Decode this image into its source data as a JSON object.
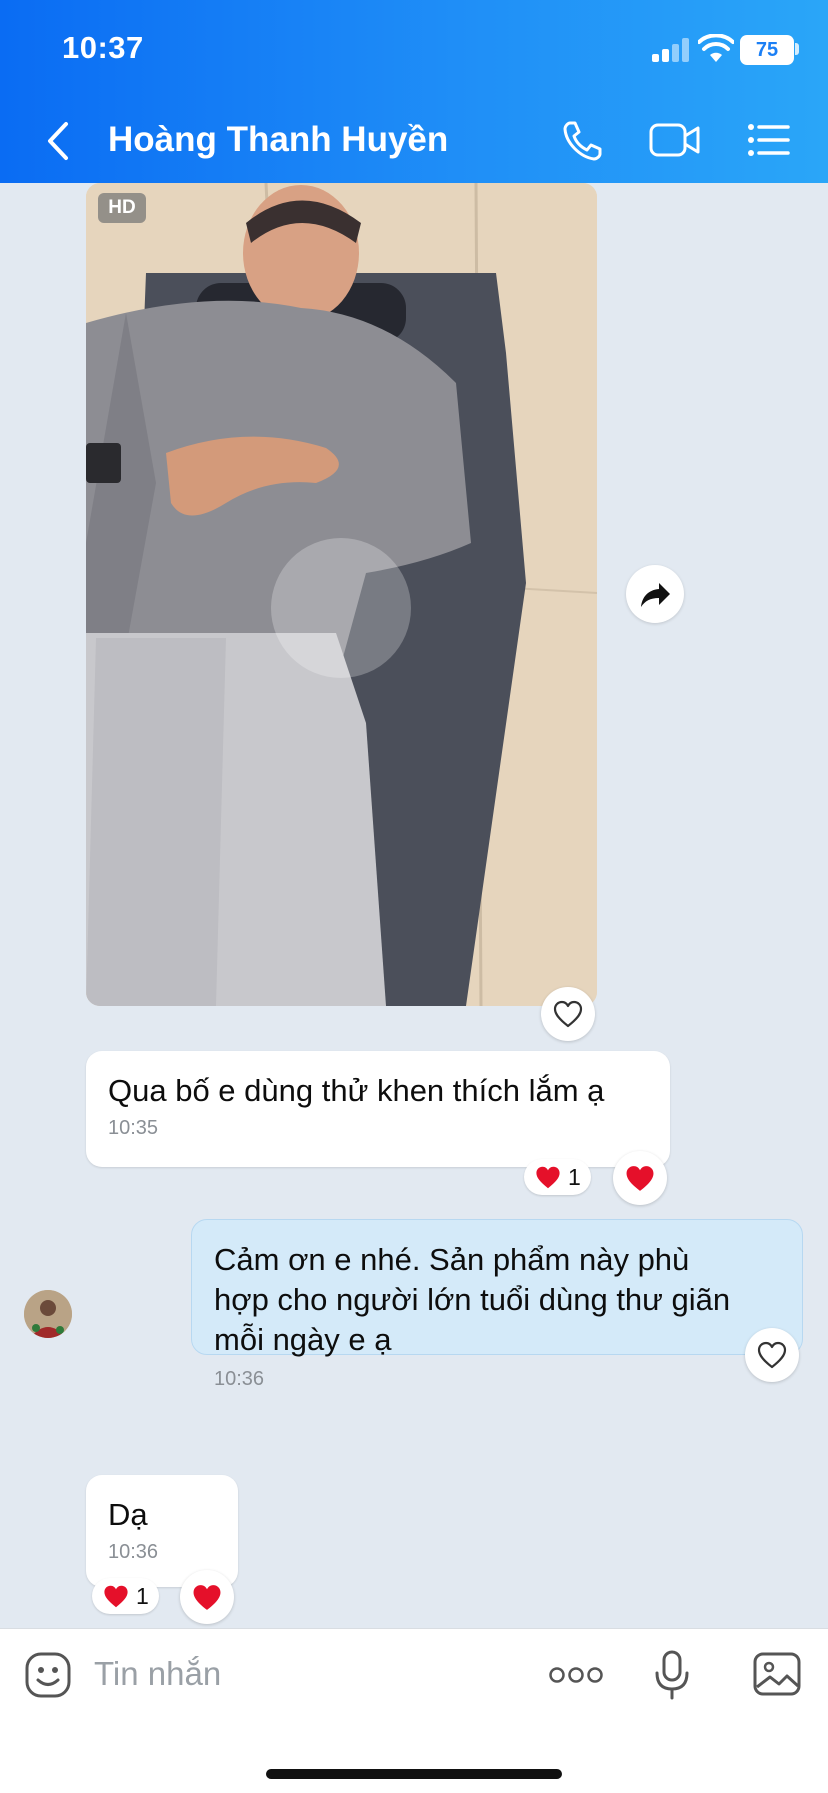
{
  "status_bar": {
    "time": "10:37",
    "battery": "75"
  },
  "header": {
    "title": "Hoàng Thanh Huyền"
  },
  "messages": {
    "photo": {
      "badge": "HD"
    },
    "m1": {
      "text": "Qua bố e dùng thử khen thích lắm ạ",
      "time": "10:35",
      "reaction_count": "1"
    },
    "m2": {
      "lines": [
        "Cảm ơn e nhé. Sản phẩm này phù",
        "hợp cho người lớn tuổi dùng thư giãn",
        "mỗi ngày e ạ"
      ],
      "time": "10:36"
    },
    "m3": {
      "text": "Dạ",
      "time": "10:36",
      "reaction_count": "1"
    }
  },
  "composer": {
    "placeholder": "Tin nhắn"
  },
  "colors": {
    "header_gradient_start": "#0a6cf3",
    "header_gradient_end": "#2aa6f8",
    "chat_bg": "#e2e9f1",
    "outgoing_bubble": "#d4eaf9",
    "heart": "#e5102a"
  },
  "icons": [
    "back-chevron-icon",
    "phone-icon",
    "video-call-icon",
    "list-menu-icon",
    "share-forward-icon",
    "heart-outline-icon",
    "heart-filled-icon",
    "sticker-icon",
    "more-icon",
    "microphone-icon",
    "image-icon"
  ]
}
